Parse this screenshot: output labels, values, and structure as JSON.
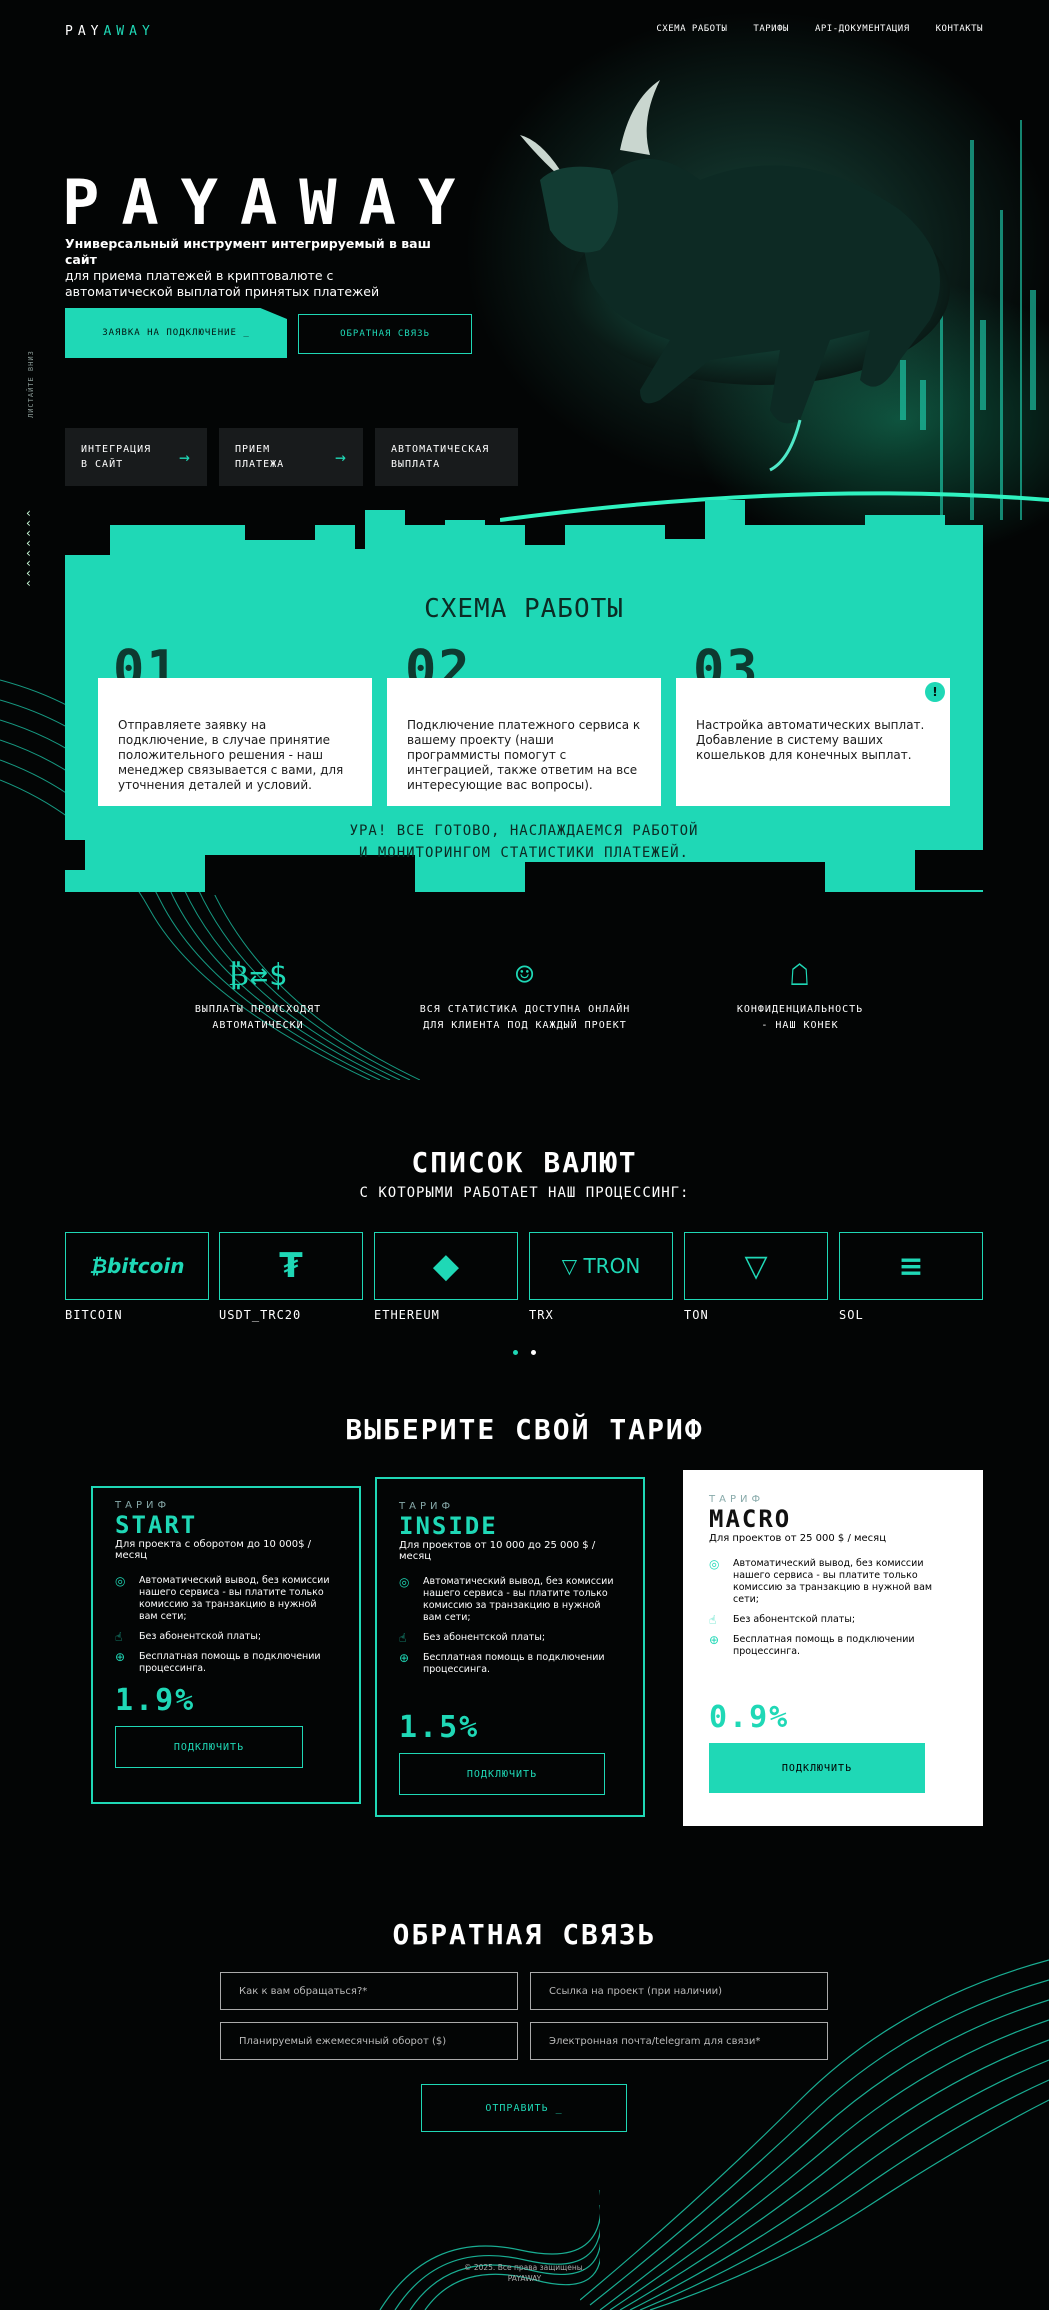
{
  "brand": {
    "logo_a": "PAY",
    "logo_b": "AWAY",
    "hero_title": "PAYAWAY"
  },
  "nav": [
    "СХЕМА РАБОТЫ",
    "ТАРИФЫ",
    "API-ДОКУМЕНТАЦИЯ",
    "КОНТАКТЫ"
  ],
  "hero": {
    "sub_bold": "Универсальный инструмент интегрируемый в ваш сайт",
    "sub_rest": "для приема платежей в криптовалюте с автоматической выплатой принятых платежей",
    "btn_main": "ЗАЯВКА НА ПОДКЛЮЧЕНИЕ _",
    "btn_out": "ОБРАТНАЯ СВЯЗЬ",
    "side": "ЛИСТАЙТЕ ВНИЗ",
    "features": [
      {
        "l1": "ИНТЕГРАЦИЯ",
        "l2": "В САЙТ"
      },
      {
        "l1": "ПРИЕМ",
        "l2": "ПЛАТЕЖА"
      },
      {
        "l1": "АВТОМАТИЧЕСКАЯ",
        "l2": "ВЫПЛАТА"
      }
    ]
  },
  "scheme": {
    "title": "СХЕМА РАБОТЫ",
    "steps": [
      {
        "num": "01",
        "text": "Отправляете заявку на подключение, в случае принятие положительного решения - наш менеджер связывается с вами, для уточнения деталей и условий."
      },
      {
        "num": "02",
        "text": "Подключение платежного сервиса к вашему проекту (наши программисты помогут с интеграцией, также ответим на все интересующие вас вопросы)."
      },
      {
        "num": "03",
        "text": "Настройка автоматических выплат. Добавление в систему ваших кошельков для конечных выплат."
      }
    ],
    "foot1": "УРА! ВСЕ ГОТОВО, НАСЛАЖДАЕМСЯ РАБОТОЙ",
    "foot2": "И МОНИТОРИНГОМ СТАТИСТИКИ ПЛАТЕЖЕЙ."
  },
  "advantages": [
    {
      "icon": "exchange-icon",
      "l1": "ВЫПЛАТЫ ПРОИСХОДЯТ",
      "l2": "АВТОМАТИЧЕСКИ"
    },
    {
      "icon": "robot-icon",
      "l1": "ВСЯ СТАТИСТИКА ДОСТУПНА ОНЛАЙН",
      "l2": "ДЛЯ КЛИЕНТА ПОД КАЖДЫЙ ПРОЕКТ"
    },
    {
      "icon": "mask-icon",
      "l1": "КОНФИДЕНЦИАЛЬНОСТЬ",
      "l2": "- НАШ КОНЕК"
    }
  ],
  "currencies": {
    "title": "СПИСОК ВАЛЮТ",
    "sub": "С КОТОРЫМИ РАБОТАЕТ НАШ ПРОЦЕССИНГ:",
    "items": [
      {
        "logo": "₿bitcoin",
        "label": "BITCOIN"
      },
      {
        "logo": "₮",
        "label": "USDT_TRC20"
      },
      {
        "logo": "◆",
        "label": "ETHEREUM"
      },
      {
        "logo": "▽ TRON",
        "label": "TRX"
      },
      {
        "logo": "▽",
        "label": "TON"
      },
      {
        "logo": "≡",
        "label": "SOL"
      }
    ]
  },
  "tariffs": {
    "title": "ВЫБЕРИТЕ СВОЙ ТАРИФ",
    "label": "ТАРИФ",
    "f1": "Автоматический вывод, без комиссии нашего сервиса - вы платите только комиссию за транзакцию в нужной вам сети;",
    "f2": "Без абонентской платы;",
    "f3": "Бесплатная помощь в подключении процессинга.",
    "btn": "ПОДКЛЮЧИТЬ",
    "plans": [
      {
        "name": "START",
        "desc": "Для проекта с оборотом до 10 000$ / месяц",
        "price": "1.9%"
      },
      {
        "name": "INSIDE",
        "desc": "Для проектов от 10 000 до 25 000 $ / месяц",
        "price": "1.5%"
      },
      {
        "name": "MACRO",
        "desc": "Для проектов от 25 000 $ / месяц",
        "price": "0.9%"
      }
    ]
  },
  "feedback": {
    "title": "ОБРАТНАЯ СВЯЗЬ",
    "f1": "Как к вам обращаться?*",
    "f2": "Ссылка на проект (при наличии)",
    "f3": "Планируемый ежемесячный оборот ($)",
    "f4": "Электронная почта/telegram для связи*",
    "send": "ОТПРАВИТЬ _"
  },
  "footer": {
    "copy": "© 2025. Все права защищены.",
    "brand": "PAYAWAY"
  },
  "colors": {
    "accent": "#1fd8b6",
    "bg": "#030505"
  }
}
